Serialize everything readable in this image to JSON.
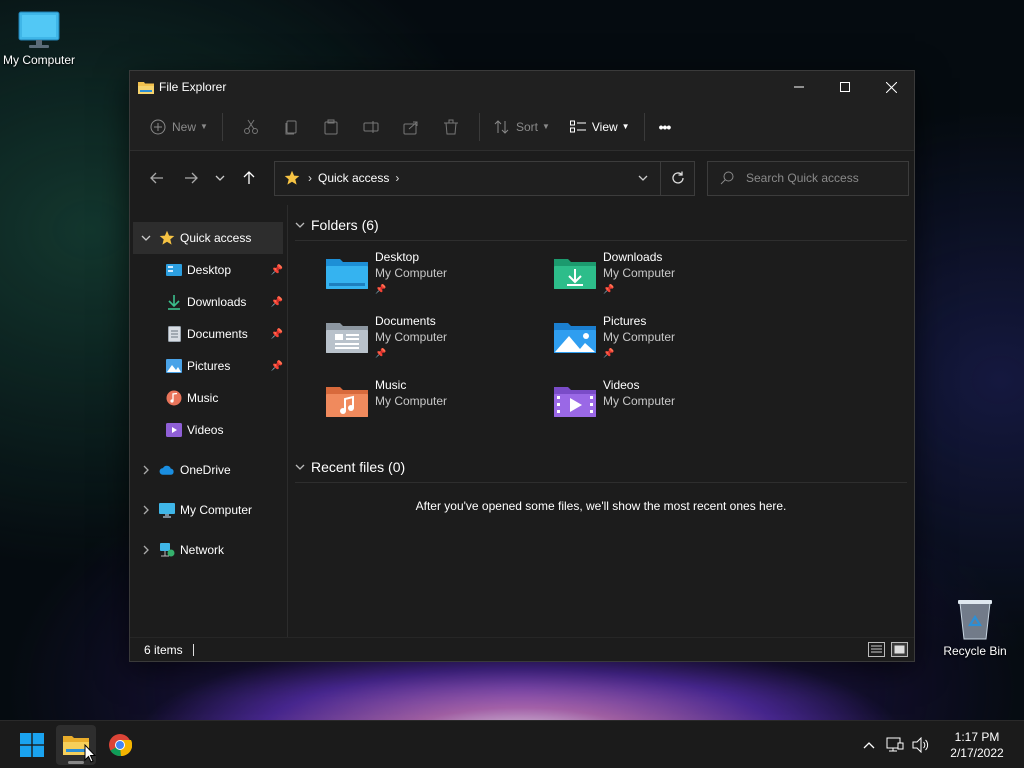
{
  "desktop": {
    "my_computer_label": "My Computer",
    "recycle_bin_label": "Recycle Bin"
  },
  "window": {
    "title": "File Explorer",
    "toolbar": {
      "new_label": "New",
      "sort_label": "Sort",
      "view_label": "View",
      "more_label": "•••"
    },
    "address": {
      "current": "Quick access",
      "separator": "›"
    },
    "search": {
      "placeholder": "Search Quick access"
    },
    "sidebar": {
      "quick_access": "Quick access",
      "pinned": [
        {
          "label": "Desktop"
        },
        {
          "label": "Downloads"
        },
        {
          "label": "Documents"
        },
        {
          "label": "Pictures"
        }
      ],
      "others": [
        {
          "label": "Music"
        },
        {
          "label": "Videos"
        }
      ],
      "onedrive": "OneDrive",
      "my_computer": "My Computer",
      "network": "Network"
    },
    "content": {
      "folders_heading": "Folders (6)",
      "folders": [
        {
          "name": "Desktop",
          "location": "My Computer",
          "pinned": true
        },
        {
          "name": "Downloads",
          "location": "My Computer",
          "pinned": true
        },
        {
          "name": "Documents",
          "location": "My Computer",
          "pinned": true
        },
        {
          "name": "Pictures",
          "location": "My Computer",
          "pinned": true
        },
        {
          "name": "Music",
          "location": "My Computer",
          "pinned": false
        },
        {
          "name": "Videos",
          "location": "My Computer",
          "pinned": false
        }
      ],
      "recent_heading": "Recent files (0)",
      "recent_empty_message": "After you've opened some files, we'll show the most recent ones here."
    },
    "status": {
      "items_count": "6 items"
    }
  },
  "taskbar": {
    "clock_time": "1:17 PM",
    "clock_date": "2/17/2022"
  },
  "colors": {
    "accent_blue": "#0a84d8",
    "folder_yellow": "#f2c14e",
    "star_yellow": "#f6c343",
    "window_bg": "#1c1c1c",
    "taskbar_bg": "#1b1b1b"
  }
}
